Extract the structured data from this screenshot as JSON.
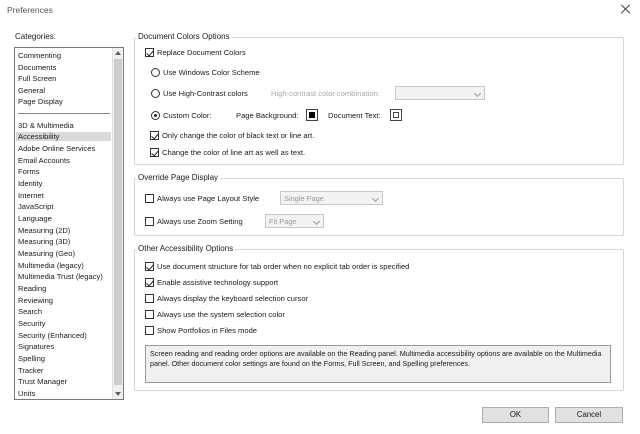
{
  "window": {
    "title": "Preferences"
  },
  "categories": {
    "label": "Categories:",
    "items": [
      {
        "label": "Commenting"
      },
      {
        "label": "Documents"
      },
      {
        "label": "Full Screen"
      },
      {
        "label": "General"
      },
      {
        "label": "Page Display"
      },
      {
        "label": "3D & Multimedia"
      },
      {
        "label": "Accessibility",
        "selected": true
      },
      {
        "label": "Adobe Online Services"
      },
      {
        "label": "Email Accounts"
      },
      {
        "label": "Forms"
      },
      {
        "label": "Identity"
      },
      {
        "label": "Internet"
      },
      {
        "label": "JavaScript"
      },
      {
        "label": "Language"
      },
      {
        "label": "Measuring (2D)"
      },
      {
        "label": "Measuring (3D)"
      },
      {
        "label": "Measuring (Geo)"
      },
      {
        "label": "Multimedia (legacy)"
      },
      {
        "label": "Multimedia Trust (legacy)"
      },
      {
        "label": "Reading"
      },
      {
        "label": "Reviewing"
      },
      {
        "label": "Search"
      },
      {
        "label": "Security"
      },
      {
        "label": "Security (Enhanced)"
      },
      {
        "label": "Signatures"
      },
      {
        "label": "Spelling"
      },
      {
        "label": "Tracker"
      },
      {
        "label": "Trust Manager"
      },
      {
        "label": "Units"
      }
    ]
  },
  "document_colors": {
    "title": "Document Colors Options",
    "replace_label": "Replace Document Colors",
    "replace_checked": true,
    "windows_scheme_label": "Use Windows Color Scheme",
    "high_contrast_label": "Use High-Contrast colors",
    "high_contrast_combo_label": "High-contrast color combination:",
    "high_contrast_combo_value": "",
    "custom_color_label": "Custom Color:",
    "custom_selected": true,
    "page_background_label": "Page Background:",
    "page_background_color": "#000000",
    "document_text_label": "Document Text:",
    "document_text_color": "#ffffff",
    "only_black_text_label": "Only change the color of black text or line art.",
    "only_black_text_checked": true,
    "line_art_label": "Change the color of line art as well as text.",
    "line_art_checked": true
  },
  "override_page_display": {
    "title": "Override Page Display",
    "page_layout_label": "Always use Page Layout Style",
    "page_layout_checked": false,
    "page_layout_value": "Single Page",
    "zoom_label": "Always use Zoom Setting",
    "zoom_checked": false,
    "zoom_value": "Fit Page"
  },
  "other_accessibility": {
    "title": "Other Accessibility Options",
    "options": [
      {
        "label": "Use document structure for tab order when no explicit tab order is specified",
        "checked": true
      },
      {
        "label": "Enable assistive technology support",
        "checked": true
      },
      {
        "label": "Always display the keyboard selection cursor",
        "checked": false
      },
      {
        "label": "Always use the system selection color",
        "checked": false
      },
      {
        "label": "Show Portfolios in Files mode",
        "checked": false
      }
    ],
    "info_text": "Screen reading and reading order options are available on the Reading panel. Multimedia accessibility options are available on the Multimedia panel. Other document color settings are found on the Forms, Full Screen, and Spelling preferences."
  },
  "buttons": {
    "ok": "OK",
    "cancel": "Cancel"
  }
}
